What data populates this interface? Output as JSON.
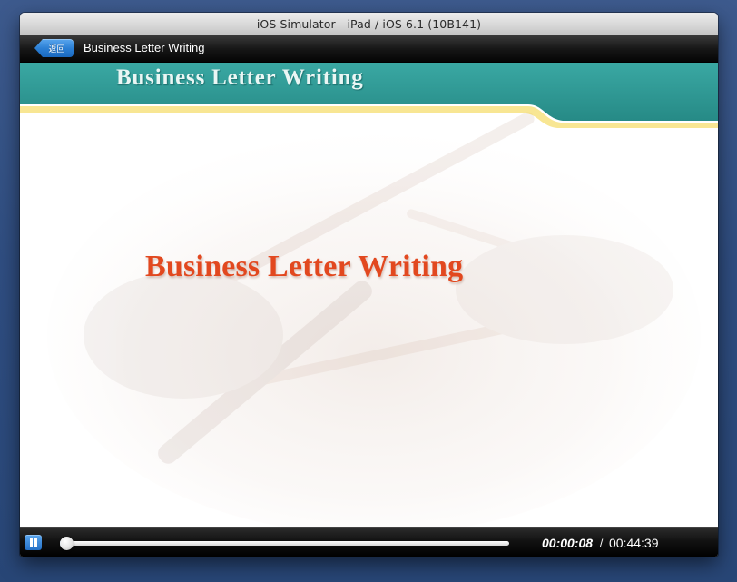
{
  "window": {
    "title": "iOS Simulator - iPad / iOS 6.1 (10B141)"
  },
  "navbar": {
    "back_label": "返回",
    "title": "Business Letter Writing"
  },
  "slide": {
    "header_title": "Business Letter Writing",
    "main_title": "Business Letter Writing"
  },
  "player": {
    "state": "playing",
    "control_icon": "pause-icon",
    "current_time": "00:00:08",
    "separator": "/",
    "total_time": "00:44:39",
    "progress_fraction": 0.003
  },
  "colors": {
    "header_teal": "#2e9a96",
    "title_orange": "#e2481f",
    "accent_blue": "#2b7fd4"
  }
}
